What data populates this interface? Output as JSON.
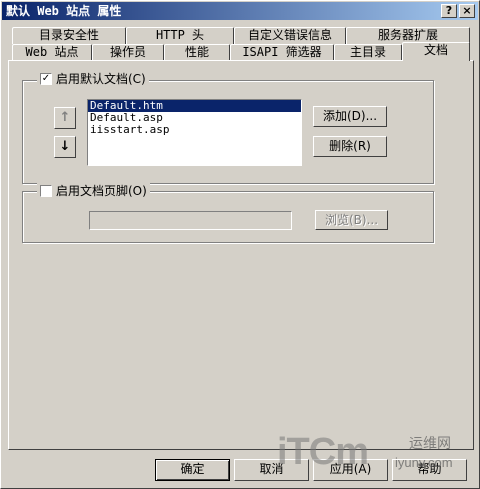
{
  "window": {
    "title": "默认 Web 站点 属性",
    "help_btn": "?",
    "close_btn": "×"
  },
  "tabs_row1": [
    "目录安全性",
    "HTTP 头",
    "自定义错误信息",
    "服务器扩展"
  ],
  "tabs_row2": [
    "Web 站点",
    "操作员",
    "性能",
    "ISAPI 筛选器",
    "主目录",
    "文档"
  ],
  "default_doc": {
    "checked": true,
    "label": "启用默认文档(C)",
    "files": [
      "Default.htm",
      "Default.asp",
      "iisstart.asp"
    ],
    "selected_index": 0,
    "up_arrow": "↑",
    "down_arrow": "↓",
    "add_label": "添加(D)...",
    "remove_label": "删除(R)"
  },
  "footer_doc": {
    "checked": false,
    "label": "启用文档页脚(O)",
    "path_value": "",
    "browse_label": "浏览(B)..."
  },
  "buttons": {
    "ok": "确定",
    "cancel": "取消",
    "apply": "应用(A)",
    "help": "帮助"
  },
  "watermark": {
    "brand": "iTCm",
    "site_text": "运维网",
    "url_text": "iyunv.com"
  }
}
